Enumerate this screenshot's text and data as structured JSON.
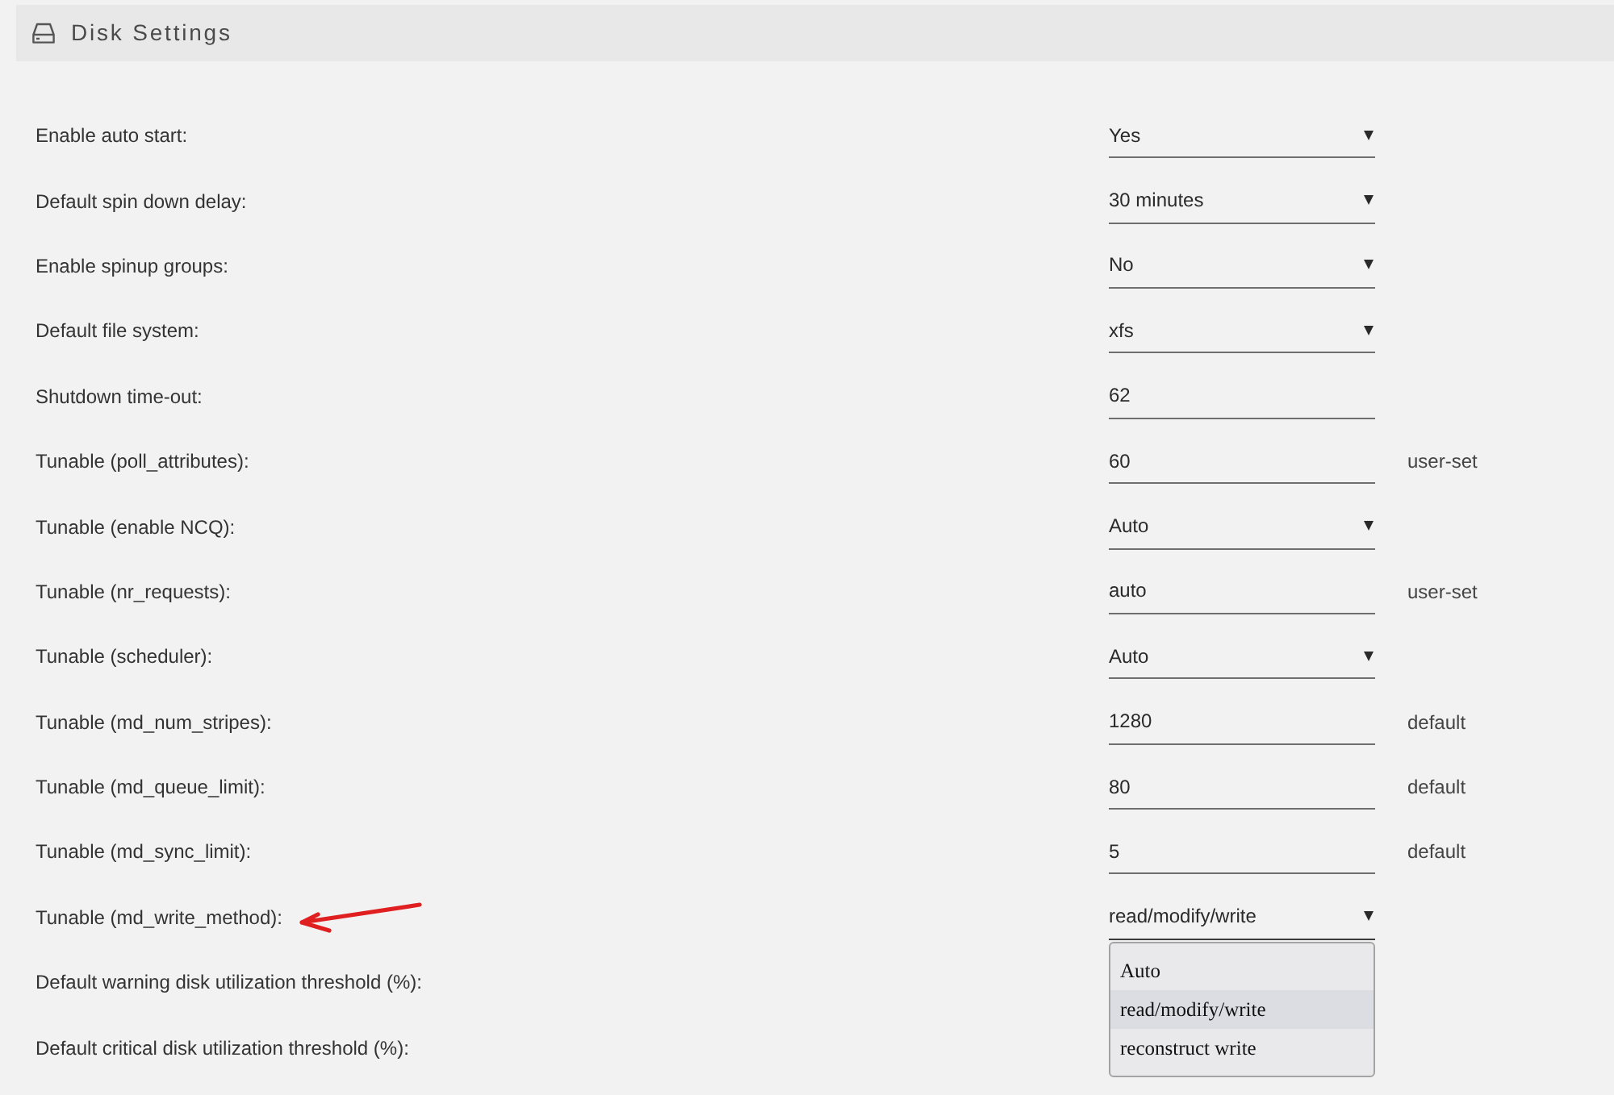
{
  "panel": {
    "title": "Disk Settings"
  },
  "settings": [
    {
      "label": "Enable auto start:",
      "marked": false,
      "control": {
        "kind": "select",
        "value": "Yes",
        "expanded": false
      }
    },
    {
      "label": "Default spin down delay:",
      "marked": false,
      "control": {
        "kind": "select",
        "value": "30 minutes",
        "expanded": false
      }
    },
    {
      "label": "Enable spinup groups:",
      "marked": false,
      "control": {
        "kind": "select",
        "value": "No",
        "expanded": false
      }
    },
    {
      "label": "Default file system:",
      "marked": false,
      "control": {
        "kind": "select",
        "value": "xfs",
        "expanded": false
      }
    },
    {
      "label": "Shutdown time-out:",
      "marked": false,
      "control": {
        "kind": "input",
        "value": "62"
      }
    },
    {
      "label": "Tunable (poll_attributes):",
      "marked": false,
      "control": {
        "kind": "input",
        "value": "60"
      },
      "note": "user-set"
    },
    {
      "label": "Tunable (enable NCQ):",
      "marked": false,
      "control": {
        "kind": "select",
        "value": "Auto",
        "expanded": false
      }
    },
    {
      "label": "Tunable (nr_requests):",
      "marked": false,
      "control": {
        "kind": "input",
        "value": "auto"
      },
      "note": "user-set"
    },
    {
      "label": "Tunable (scheduler):",
      "marked": false,
      "control": {
        "kind": "select",
        "value": "Auto",
        "expanded": false
      }
    },
    {
      "label": "Tunable (md_num_stripes):",
      "marked": false,
      "control": {
        "kind": "input",
        "value": "1280"
      },
      "note": "default"
    },
    {
      "label": "Tunable (md_queue_limit):",
      "marked": false,
      "control": {
        "kind": "input",
        "value": "80"
      },
      "note": "default"
    },
    {
      "label": "Tunable (md_sync_limit):",
      "marked": false,
      "control": {
        "kind": "input",
        "value": "5"
      },
      "note": "default"
    },
    {
      "label": "Tunable (md_write_method):",
      "marked": true,
      "control": {
        "kind": "select",
        "value": "read/modify/write",
        "expanded": true,
        "options": [
          {
            "label": "Auto",
            "selected": false
          },
          {
            "label": "read/modify/write",
            "selected": true
          },
          {
            "label": "reconstruct write",
            "selected": false
          }
        ]
      }
    },
    {
      "label": "Default warning disk utilization threshold (%):",
      "marked": false
    },
    {
      "label": "Default critical disk utilization threshold (%):",
      "marked": false
    }
  ]
}
